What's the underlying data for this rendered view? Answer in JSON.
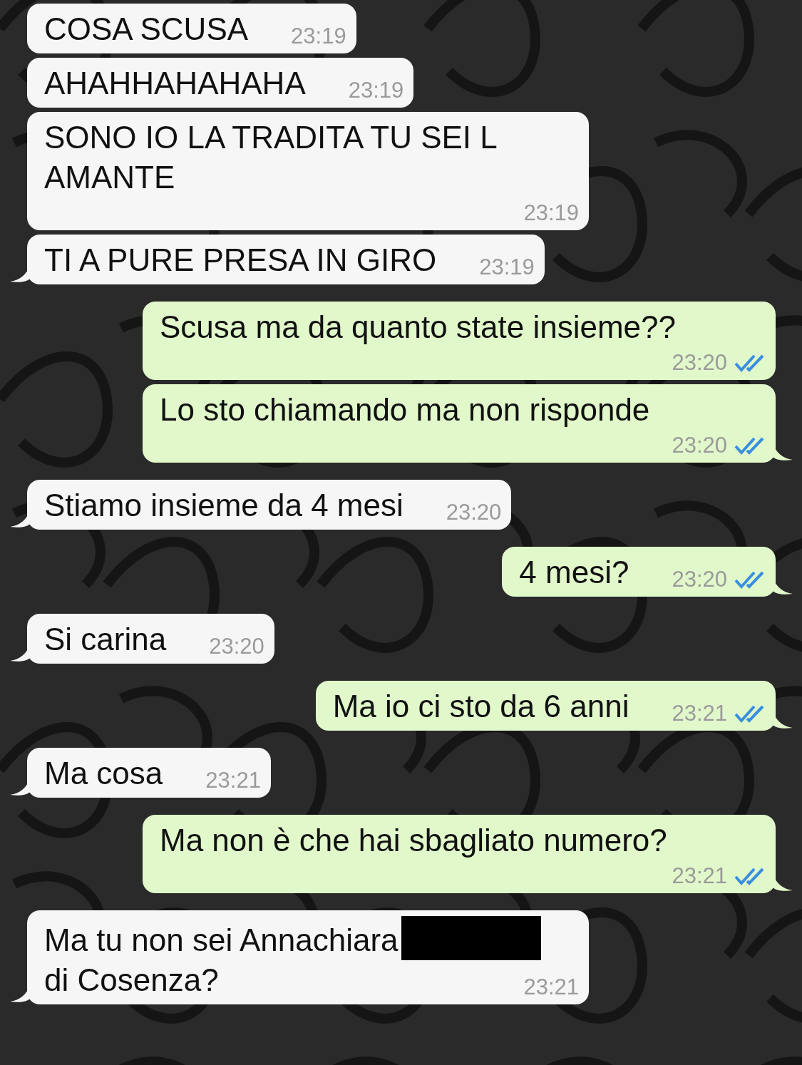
{
  "messages": [
    {
      "kind": "received",
      "text": "COSA SCUSA",
      "time": "23:19",
      "tail": false
    },
    {
      "kind": "received",
      "text": "AHAHHAHAHAHA",
      "time": "23:19",
      "tail": false
    },
    {
      "kind": "received",
      "text": "SONO IO LA TRADITA TU SEI L AMANTE",
      "time": "23:19",
      "tail": false
    },
    {
      "kind": "received",
      "text": "TI A PURE PRESA IN GIRO",
      "time": "23:19",
      "tail": true
    },
    {
      "kind": "sent",
      "text": "Scusa ma da quanto state insieme??",
      "time": "23:20",
      "read": true,
      "tail": false
    },
    {
      "kind": "sent",
      "text": "Lo sto chiamando ma non risponde",
      "time": "23:20",
      "read": true,
      "tail": true
    },
    {
      "kind": "received",
      "text": "Stiamo insieme da 4 mesi",
      "time": "23:20",
      "tail": true
    },
    {
      "kind": "sent",
      "text": "4 mesi?",
      "time": "23:20",
      "read": true,
      "tail": true
    },
    {
      "kind": "received",
      "text": "Si carina",
      "time": "23:20",
      "tail": true
    },
    {
      "kind": "sent",
      "text": "Ma io ci sto da 6 anni",
      "time": "23:21",
      "read": true,
      "tail": true
    },
    {
      "kind": "received",
      "text": "Ma cosa",
      "time": "23:21",
      "tail": true
    },
    {
      "kind": "sent",
      "text": "Ma non è che hai sbagliato numero?",
      "time": "23:21",
      "read": true,
      "tail": true
    },
    {
      "kind": "received",
      "text": "Ma tu non sei Annachiara",
      "redacted": true,
      "text_after": "di Cosenza?",
      "time": "23:21",
      "tail": true
    }
  ]
}
